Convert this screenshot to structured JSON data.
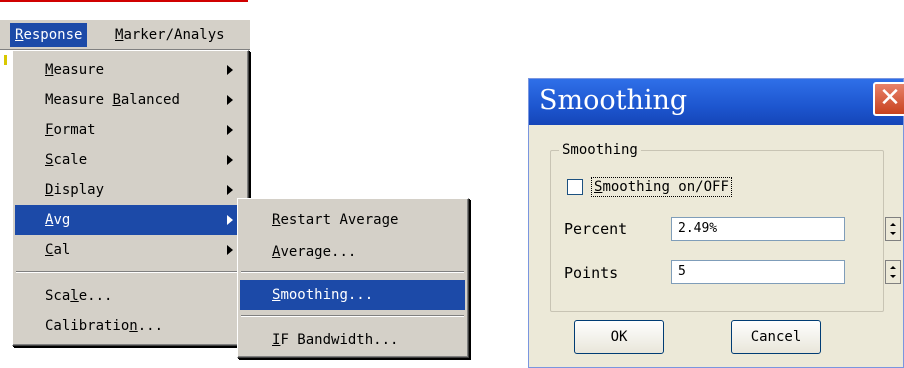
{
  "menubar": {
    "items": [
      {
        "label": "Response",
        "mnemonic": "R",
        "rest": "esponse"
      },
      {
        "label": "Marker/Analys",
        "mnemonic": "M",
        "rest": "arker/Analys"
      }
    ]
  },
  "main_menu": {
    "items": [
      {
        "pre": "",
        "mn": "M",
        "post": "easure",
        "submenu": true
      },
      {
        "pre": "Measure ",
        "mn": "B",
        "post": "alanced",
        "submenu": true
      },
      {
        "pre": "",
        "mn": "F",
        "post": "ormat",
        "submenu": true
      },
      {
        "pre": "",
        "mn": "S",
        "post": "cale",
        "submenu": true
      },
      {
        "pre": "",
        "mn": "D",
        "post": "isplay",
        "submenu": true
      },
      {
        "pre": "",
        "mn": "A",
        "post": "vg",
        "submenu": true,
        "highlighted": true
      },
      {
        "pre": "",
        "mn": "C",
        "post": "al",
        "submenu": true
      },
      {
        "pre": "Sca",
        "mn": "l",
        "post": "e...",
        "submenu": false
      },
      {
        "pre": "Calibratio",
        "mn": "n",
        "post": "...",
        "submenu": false
      }
    ]
  },
  "avg_submenu": {
    "items": [
      {
        "pre": "",
        "mn": "R",
        "post": "estart Average"
      },
      {
        "pre": "",
        "mn": "A",
        "post": "verage..."
      },
      {
        "pre": "",
        "mn": "S",
        "post": "moothing...",
        "highlighted": true
      },
      {
        "pre": "",
        "mn": "I",
        "post": "F Bandwidth..."
      }
    ]
  },
  "dialog": {
    "title": "Smoothing",
    "close_icon": "close-icon",
    "group_label": "Smoothing",
    "checkbox": {
      "mn": "S",
      "post": "moothing on/OFF",
      "checked": false
    },
    "percent": {
      "label": "Percent",
      "value": "2.49%"
    },
    "points": {
      "label": "Points",
      "value": "5"
    },
    "ok_label": "OK",
    "cancel_label": "Cancel"
  },
  "colors": {
    "menu_bg": "#d4d0c8",
    "highlight": "#1c4aa8",
    "dialog_bg": "#ece9d8",
    "titlebar": "#1d56cf",
    "close_button": "#c8421f"
  }
}
